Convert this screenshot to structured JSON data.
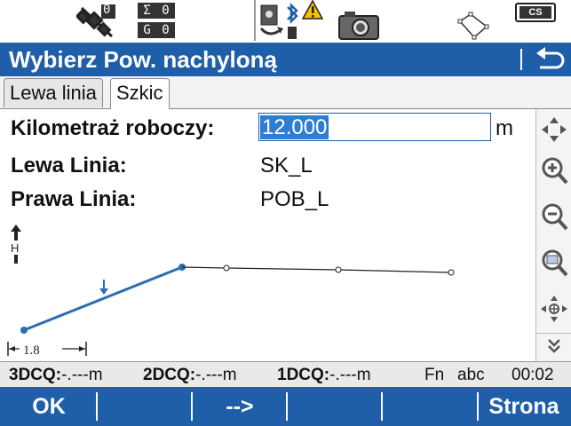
{
  "status": {
    "sigma_label": "Σ",
    "sigma_value": "0",
    "g_label": "G",
    "g_value": "0",
    "satellite_count": "0",
    "cs_label": "CS",
    "icons": [
      "satellite-icon",
      "instrument-bluetooth-icon",
      "warning-icon",
      "camera-icon",
      "sketch-area-icon",
      "battery-cs-icon"
    ]
  },
  "title": {
    "text": "Wybierz Pow. nachyloną",
    "back_icon": "back-arrow-icon"
  },
  "tabs": [
    {
      "label": "Lewa linia",
      "active": false
    },
    {
      "label": "Szkic",
      "active": true
    }
  ],
  "form": {
    "chainage_label": "Kilometraż roboczy:",
    "chainage_value": "12.000",
    "chainage_unit": "m",
    "left_line_label": "Lewa Linia:",
    "left_line_value": "SK_L",
    "right_line_label": "Prawa Linia:",
    "right_line_value": "POB_L"
  },
  "sketch": {
    "height_marker": "H",
    "scale_label": "1.8",
    "line_color": "#2a6db5"
  },
  "right_toolbar": [
    "pan-icon",
    "zoom-in-icon",
    "zoom-out-icon",
    "zoom-extent-icon",
    "center-icon",
    "more-down-icon"
  ],
  "info": {
    "dcq3_label": "3DCQ:",
    "dcq3_value": "-.---m",
    "dcq2_label": "2DCQ:",
    "dcq2_value": "-.---m",
    "dcq1_label": "1DCQ:",
    "dcq1_value": "-.---m",
    "fn": "Fn",
    "input_mode": "abc",
    "time": "00:02"
  },
  "softkeys": {
    "ok": "OK",
    "next": "-->",
    "page": "Strona"
  },
  "colors": {
    "accent": "#1f5ea8",
    "selection": "#2f7cd6"
  }
}
